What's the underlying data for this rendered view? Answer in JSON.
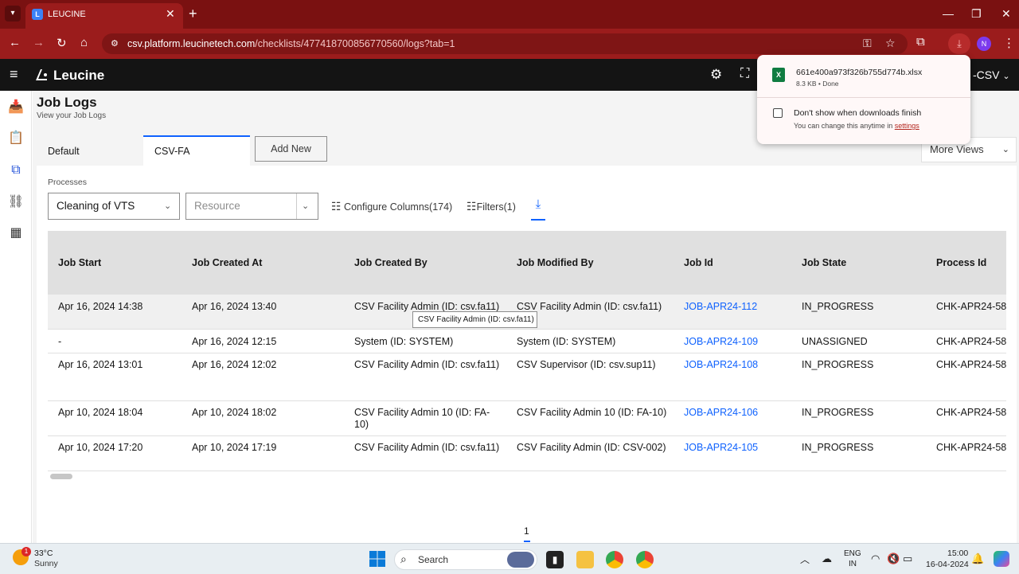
{
  "browser": {
    "tab_title": "LEUCINE",
    "tab_close": "✕",
    "new_tab": "+",
    "url_host": "csv.platform.leucinetech.com",
    "url_path": "/checklists/477418700856770560/logs?tab=1",
    "profile_initial": "N"
  },
  "app": {
    "brand": "Leucine",
    "facility_label": "-CSV",
    "page_title": "Job Logs",
    "page_subtitle": "View your Job Logs",
    "views": [
      "Default",
      "CSV-FA"
    ],
    "add_new": "Add New",
    "more_views": "More Views",
    "processes_label": "Processes",
    "process_value": "Cleaning of VTS",
    "resource_placeholder": "Resource",
    "configure_columns": "Configure Columns(174)",
    "filters": "Filters(1)",
    "page_number": "1"
  },
  "table": {
    "columns": [
      "Job Start",
      "Job Created At",
      "Job Created By",
      "Job Modified By",
      "Job Id",
      "Job State",
      "Process Id"
    ],
    "rows": [
      [
        "Apr 16, 2024 14:38",
        "Apr 16, 2024 13:40",
        "CSV Facility Admin (ID: csv.fa11)",
        "CSV Facility Admin (ID: csv.fa11)",
        "JOB-APR24-112",
        "IN_PROGRESS",
        "CHK-APR24-58"
      ],
      [
        "-",
        "Apr 16, 2024 12:15",
        "System (ID: SYSTEM)",
        "System (ID: SYSTEM)",
        "JOB-APR24-109",
        "UNASSIGNED",
        "CHK-APR24-58"
      ],
      [
        "Apr 16, 2024 13:01",
        "Apr 16, 2024 12:02",
        "CSV Facility Admin (ID: csv.fa11)",
        "CSV Supervisor (ID: csv.sup11)",
        "JOB-APR24-108",
        "IN_PROGRESS",
        "CHK-APR24-58"
      ],
      [
        "Apr 10, 2024 18:04",
        "Apr 10, 2024 18:02",
        "CSV Facility Admin 10 (ID: FA-10)",
        "CSV Facility Admin 10 (ID: FA-10)",
        "JOB-APR24-106",
        "IN_PROGRESS",
        "CHK-APR24-58"
      ],
      [
        "Apr 10, 2024 17:20",
        "Apr 10, 2024 17:19",
        "CSV Facility Admin (ID: csv.fa11)",
        "CSV Facility Admin (ID: CSV-002)",
        "JOB-APR24-105",
        "IN_PROGRESS",
        "CHK-APR24-58"
      ]
    ],
    "tooltip": "CSV Facility Admin  (ID: csv.fa11)"
  },
  "download_popup": {
    "file_name": "661e400a973f326b755d774b.xlsx",
    "file_meta": "8.3 KB • Done",
    "dont_show": "Don't show when downloads finish",
    "hint": "You can change this anytime in ",
    "hint_link": "settings"
  },
  "taskbar": {
    "temperature": "33°C",
    "condition": "Sunny",
    "weather_badge": "1",
    "search": "Search",
    "lang_line1": "ENG",
    "lang_line2": "IN",
    "time": "15:00",
    "date": "16-04-2024"
  },
  "colors": {
    "browser_frame": "#7a1111",
    "app_header": "#141414",
    "accent": "#0f62fe"
  }
}
